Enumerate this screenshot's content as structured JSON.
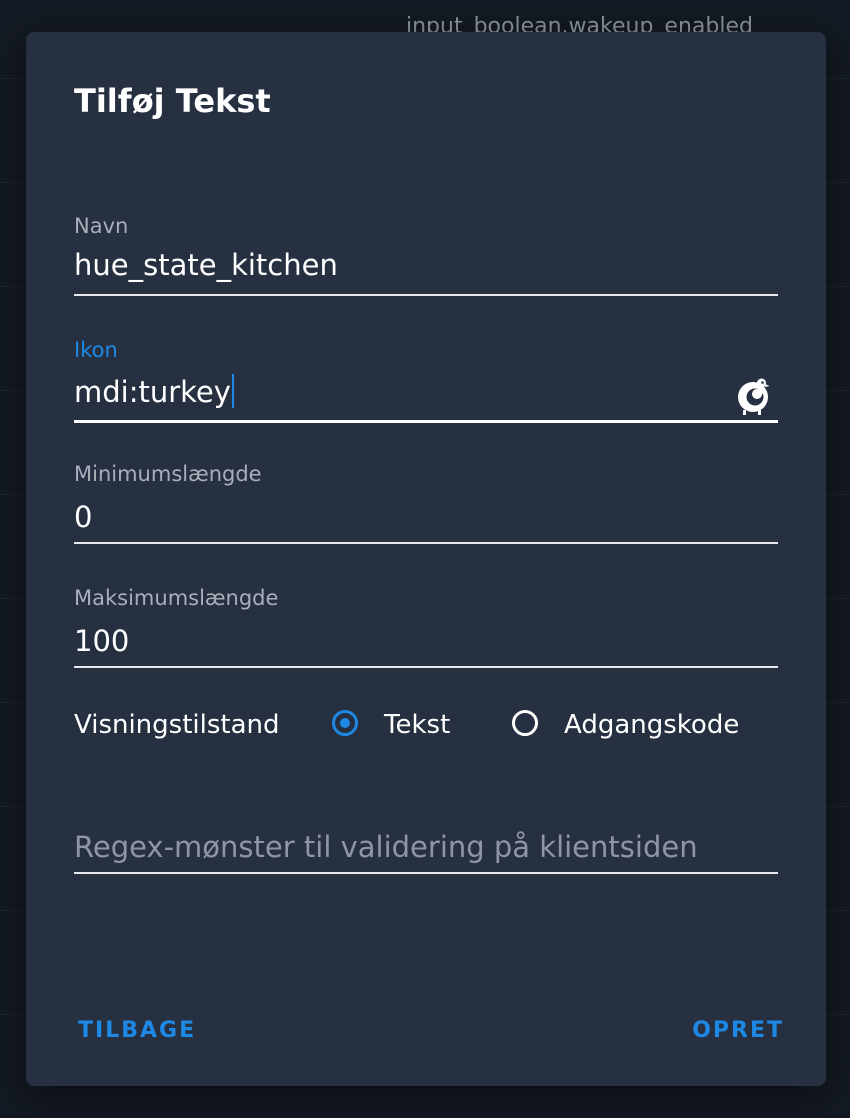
{
  "background": {
    "entity_text": "input_boolean.wakeup_enabled"
  },
  "dialog": {
    "title": "Tilføj Tekst",
    "fields": {
      "name": {
        "label": "Navn",
        "value": "hue_state_kitchen"
      },
      "icon": {
        "label": "Ikon",
        "value": "mdi:turkey",
        "icon_name": "turkey-icon"
      },
      "min_length": {
        "label": "Minimumslængde",
        "value": "0"
      },
      "max_length": {
        "label": "Maksimumslængde",
        "value": "100"
      }
    },
    "display_mode": {
      "label": "Visningstilstand",
      "options": [
        {
          "label": "Tekst",
          "selected": true
        },
        {
          "label": "Adgangskode",
          "selected": false
        }
      ]
    },
    "pattern": {
      "placeholder": "Regex-mønster til validering på klientsiden",
      "value": ""
    },
    "buttons": {
      "back": "TILBAGE",
      "create": "OPRET"
    },
    "colors": {
      "accent": "#1e88e5",
      "dialog_bg": "#263041",
      "page_bg": "#141a23"
    }
  }
}
